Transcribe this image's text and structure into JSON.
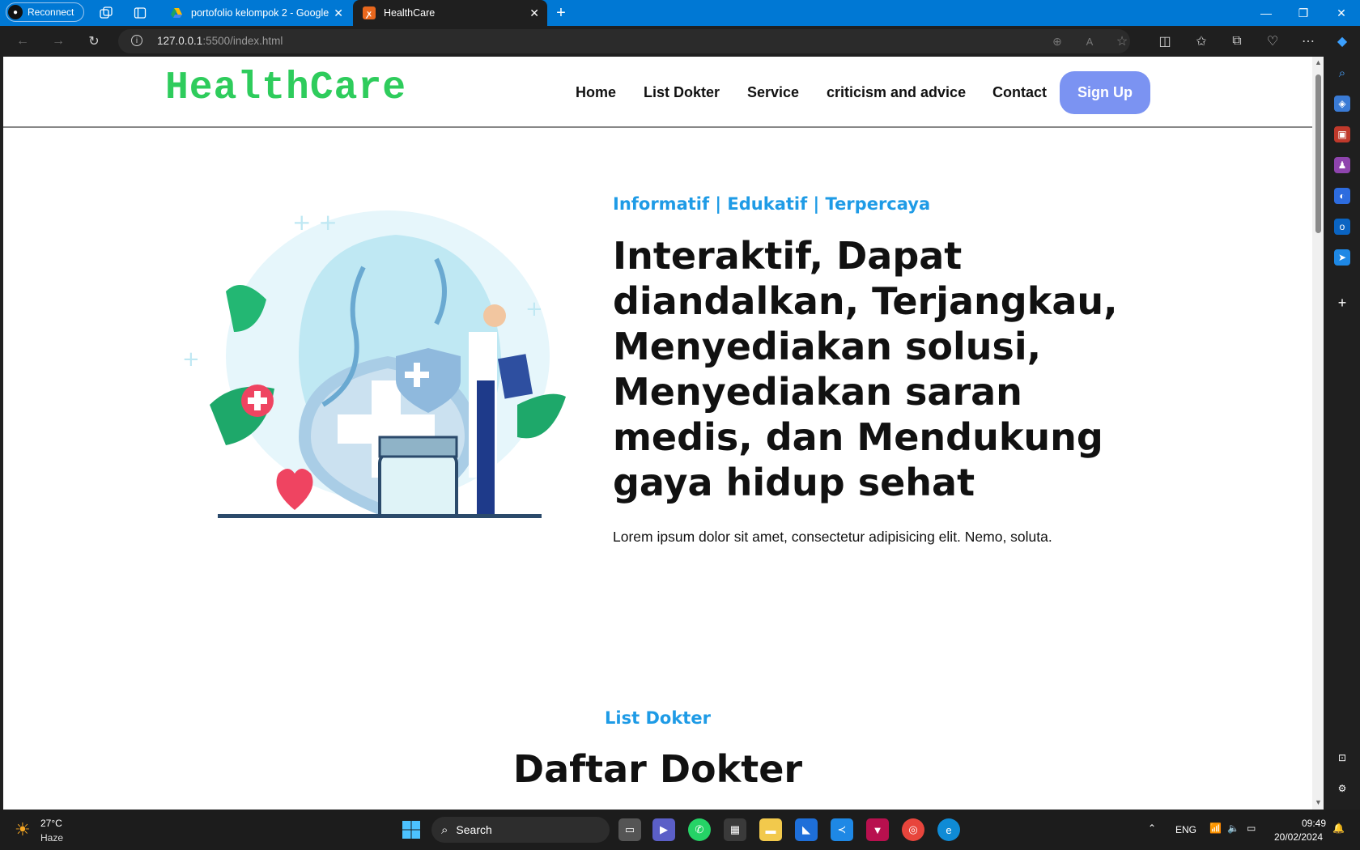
{
  "browser": {
    "reconnect_label": "Reconnect",
    "tabs": [
      {
        "title": "portofolio kelompok 2 - Google",
        "active": false
      },
      {
        "title": "HealthCare",
        "active": true
      }
    ],
    "url_host": "127.0.0.1",
    "url_path": ":5500/index.html"
  },
  "site": {
    "logo": "HealthCare",
    "nav": [
      "Home",
      "List Dokter",
      "Service",
      "criticism and advice",
      "Contact"
    ],
    "signup_label": "Sign Up",
    "hero": {
      "eyebrow": "Informatif | Edukatif | Terpercaya",
      "title": "Interaktif, Dapat diandalkan, Terjangkau, Menyediakan solusi, Menyediakan saran medis, dan Mendukung gaya hidup sehat",
      "text": "Lorem ipsum dolor sit amet, consectetur adipisicing elit. Nemo, soluta."
    },
    "doctors": {
      "eyebrow": "List Dokter",
      "title": "Daftar Dokter"
    }
  },
  "taskbar": {
    "weather_temp": "27°C",
    "weather_desc": "Haze",
    "search_label": "Search",
    "lang": "ENG",
    "time": "09:49",
    "date": "20/02/2024"
  },
  "colors": {
    "accent": "#0078d4",
    "logo": "#2ecc5c",
    "eyebrow": "#1e9be6",
    "signup": "#7b93f2"
  }
}
